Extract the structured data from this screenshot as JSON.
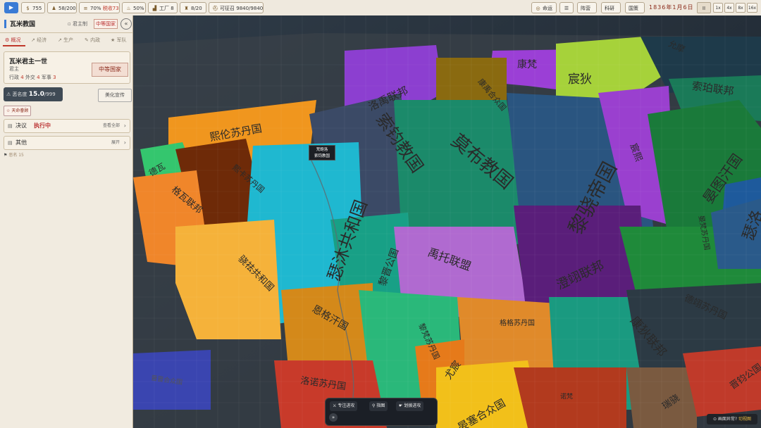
{
  "topbar": {
    "play_icon": "▶",
    "gold": "755",
    "pop": "58/200",
    "tax": "70%",
    "tax_label": "税收73%",
    "stability": "50%",
    "factory_label": "工厂",
    "factory": "8",
    "generals": "8/20",
    "conscript_label": "可征召",
    "conscript": "9840/9840",
    "btn_fate": "命运",
    "btn_menu": "☰",
    "btn_army": "阵营",
    "btn_tech": "科研",
    "btn_diplo": "国策",
    "date": "1836年1月6日",
    "pause": "II",
    "speeds": [
      "1x",
      "4x",
      "8x",
      "16x"
    ]
  },
  "panel": {
    "nation": "瓦米教国",
    "government": "君主制",
    "rank_badge": "中等国家",
    "close": "«",
    "tabs": [
      "概况",
      "经济",
      "生产",
      "内政",
      "军队"
    ],
    "ruler_name": "瓦米君主一世",
    "ruler_title": "君主",
    "stats_label": [
      "行政",
      "外交",
      "军事"
    ],
    "stats": [
      "4",
      "4",
      "3"
    ],
    "rank": "中等国家",
    "infamy_label": "恶名度",
    "infamy": "15.0",
    "infamy_max": "/999",
    "beautify": "美化宣传",
    "mandate": "天命眷顾",
    "decision_label": "决议",
    "decision_status": "执行中",
    "decision_action": "查看全部",
    "other_label": "其他",
    "other_action": "展开",
    "history": "恶名 15"
  },
  "map": {
    "tooltip_line1": "梵鲍洛",
    "tooltip_line2": "索钧教国",
    "labels": [
      {
        "t": "洛禹联邦"
      },
      {
        "t": "康梵"
      },
      {
        "t": "宸狄"
      },
      {
        "t": "允摩"
      },
      {
        "t": "康禹合众国"
      },
      {
        "t": "索珀联邦"
      },
      {
        "t": "熙伦苏丹国"
      },
      {
        "t": "索钧教国"
      },
      {
        "t": "莫布教国"
      },
      {
        "t": "黎骁帝国"
      },
      {
        "t": "宸熙"
      },
      {
        "t": "晏图汗国"
      },
      {
        "t": "德瓦"
      },
      {
        "t": "熙卡苏丹国"
      },
      {
        "t": "瑟沐共和国"
      },
      {
        "t": "格瓦联邦"
      },
      {
        "t": "黎晋公国"
      },
      {
        "t": "禹托联盟"
      },
      {
        "t": "澄翊联邦"
      },
      {
        "t": "晏梵苏丹国"
      },
      {
        "t": "瑟洛"
      },
      {
        "t": "骁祛共和国"
      },
      {
        "t": "恩格汗国"
      },
      {
        "t": "黎梵苏丹国"
      },
      {
        "t": "格格苏丹国"
      },
      {
        "t": "康狄联邦"
      },
      {
        "t": "德翊苏丹国"
      },
      {
        "t": "尤宸"
      },
      {
        "t": "洛诺苏丹国"
      },
      {
        "t": "晏塞合众国"
      },
      {
        "t": "瑞骁"
      },
      {
        "t": "晋钧公国"
      },
      {
        "t": "诺梵"
      },
      {
        "t": "晋晋合众国"
      }
    ]
  },
  "bottom": {
    "btn1": "专注进攻",
    "btn2": "指图",
    "btn3": "划拨进攻",
    "expand": "»"
  },
  "error": {
    "text": "画面异常?",
    "link": "切视图"
  }
}
